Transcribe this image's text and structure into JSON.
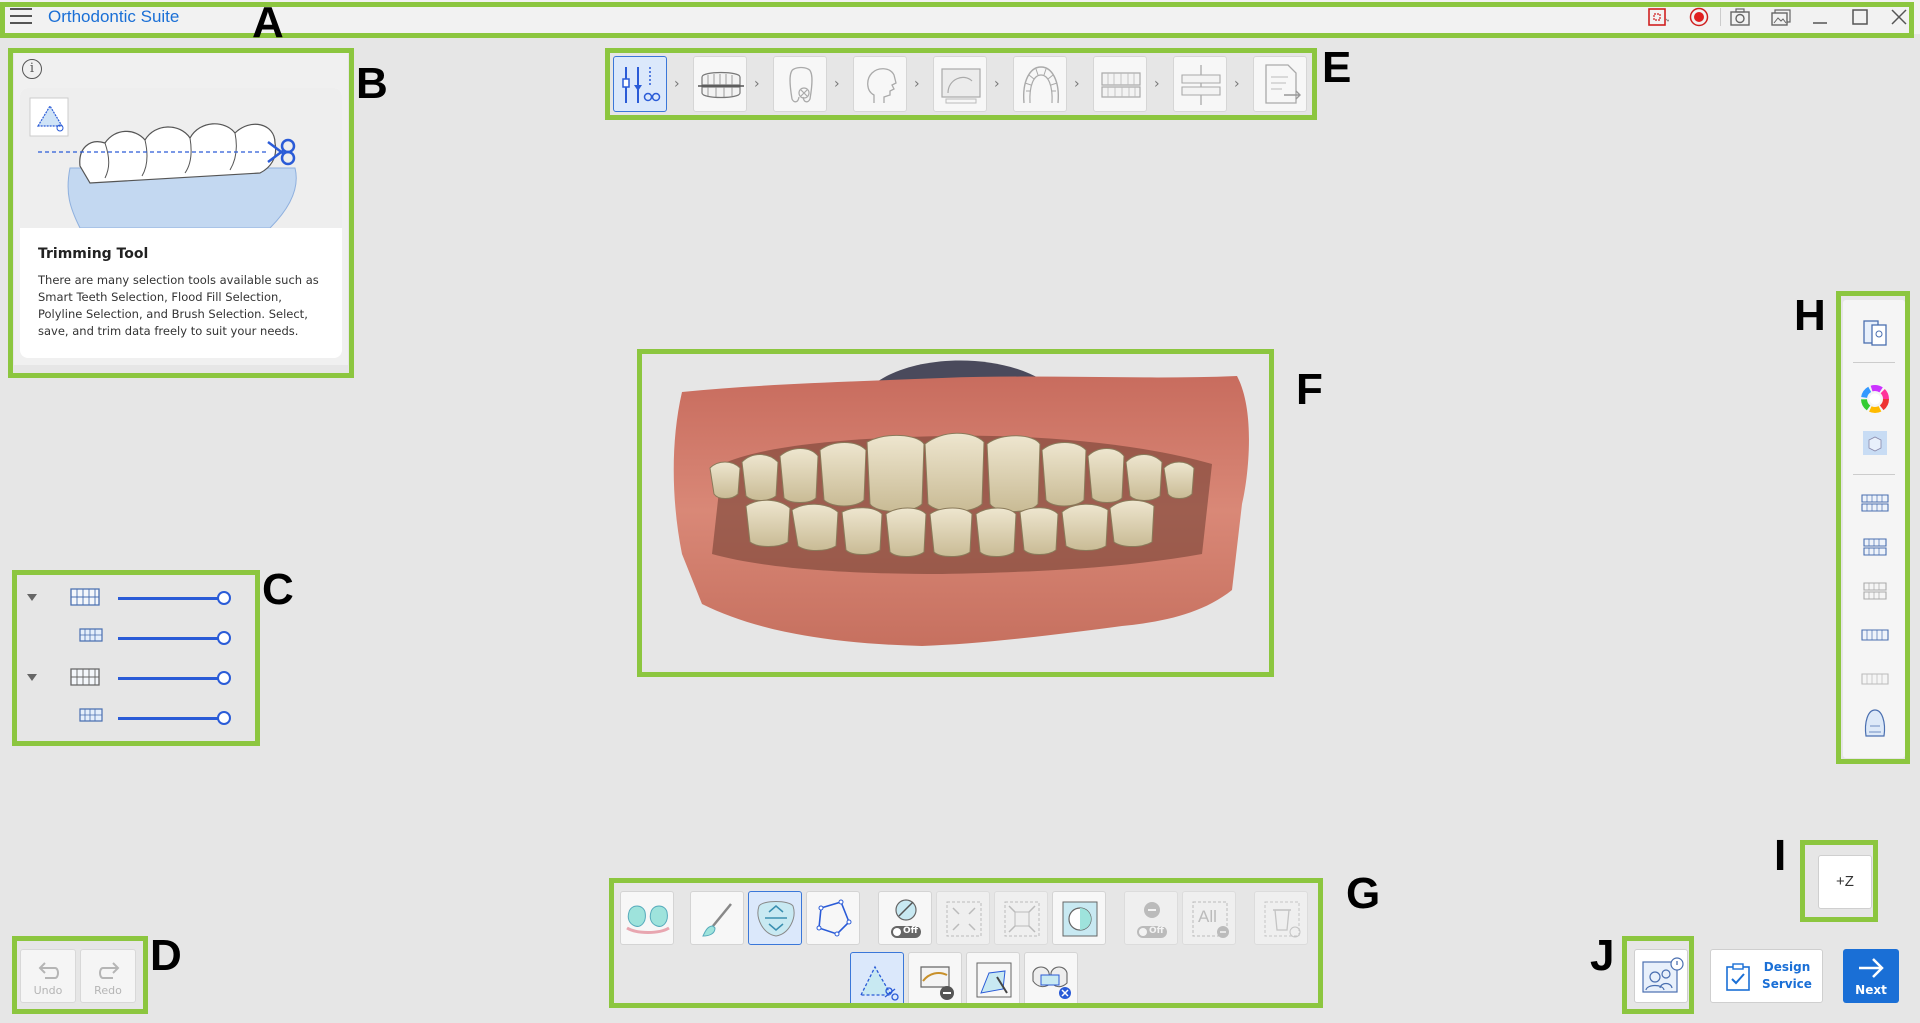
{
  "app": {
    "title": "Orthodontic Suite"
  },
  "annotations": {
    "A": "A",
    "B": "B",
    "C": "C",
    "D": "D",
    "E": "E",
    "F": "F",
    "G": "G",
    "H": "H",
    "I": "I",
    "J": "J"
  },
  "info_panel": {
    "title": "Trimming Tool",
    "description": "There are many selection tools available such as Smart Teeth Selection, Flood Fill Selection, Polyline Selection, and Brush Selection. Select, save, and trim data freely to suit your needs."
  },
  "history": {
    "undo_label": "Undo",
    "redo_label": "Redo"
  },
  "bottom_tools": {
    "toggle_off_label": "Off",
    "select_all_label": "All"
  },
  "z_button": {
    "label": "+Z"
  },
  "design_service": {
    "label_line1": "Design",
    "label_line2": "Service"
  },
  "next_button": {
    "label": "Next"
  },
  "colors": {
    "accent": "#1a6fd6",
    "highlight": "#8cc63f",
    "record": "#e02020"
  }
}
